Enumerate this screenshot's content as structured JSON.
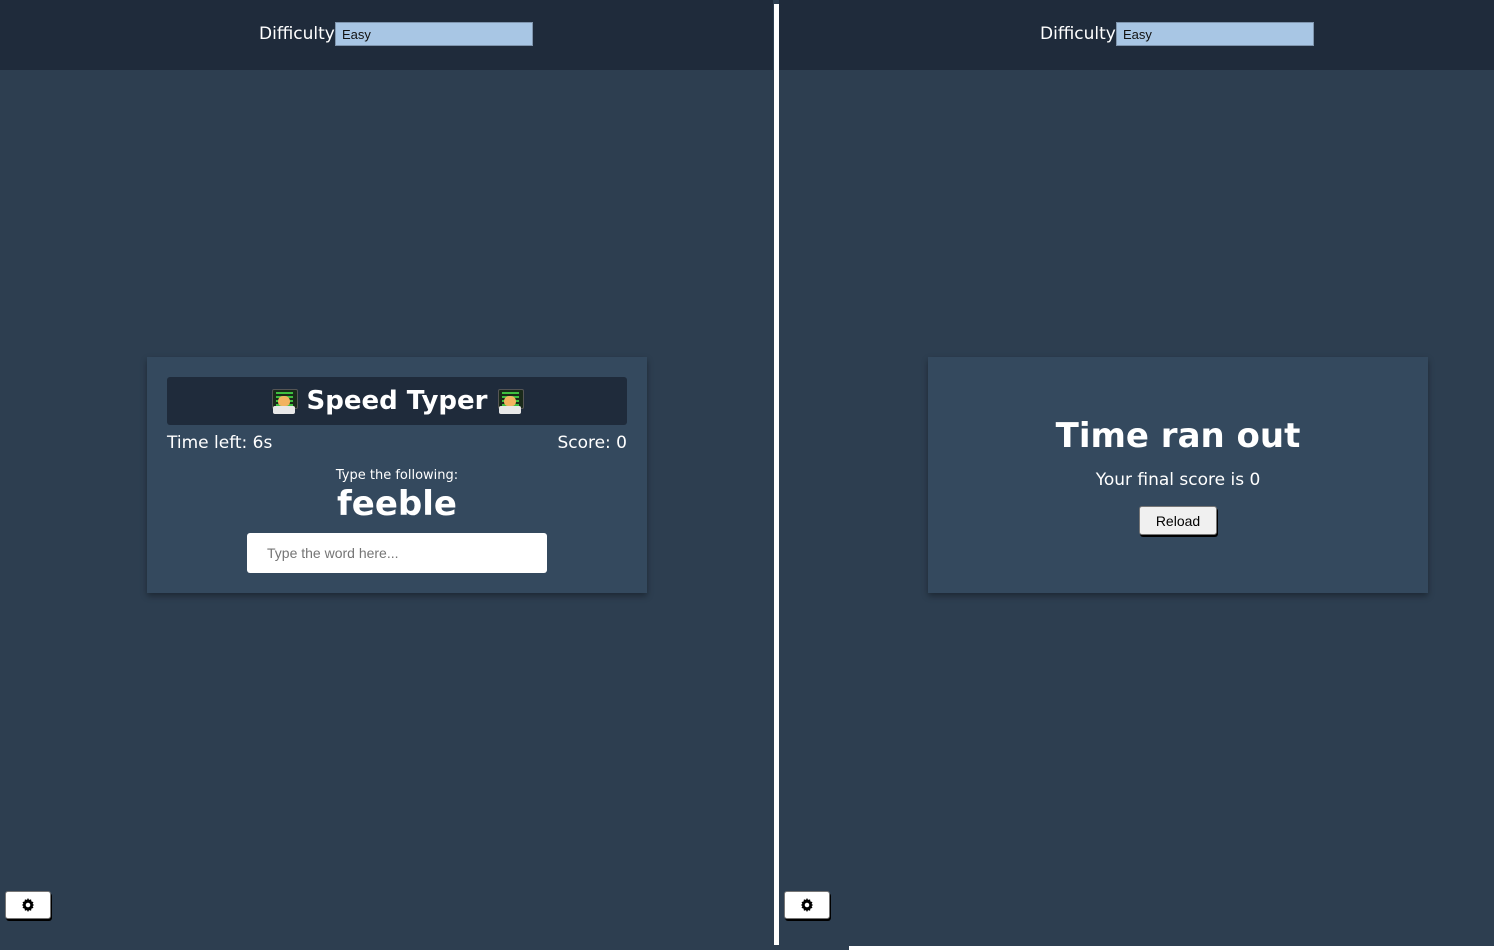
{
  "left_panel": {
    "difficulty_label": "Difficulty",
    "difficulty_value": "Easy",
    "game": {
      "title": "Speed Typer",
      "time_left": "Time left: 6s",
      "score": "Score: 0",
      "prompt": "Type the following:",
      "word": "feeble",
      "input_placeholder": "Type the word here...",
      "title_icon": "technologist-emoji-icon"
    },
    "settings_icon": "gear-icon"
  },
  "right_panel": {
    "difficulty_label": "Difficulty",
    "difficulty_value": "Easy",
    "end_screen": {
      "title": "Time ran out",
      "final_score": "Your final score is 0",
      "reload_label": "Reload"
    },
    "settings_icon": "gear-icon"
  },
  "colors": {
    "background": "#2d3e50",
    "header": "#1f2b3b",
    "card": "#34495e",
    "select": "#a8c6e4",
    "text": "#ffffff"
  }
}
